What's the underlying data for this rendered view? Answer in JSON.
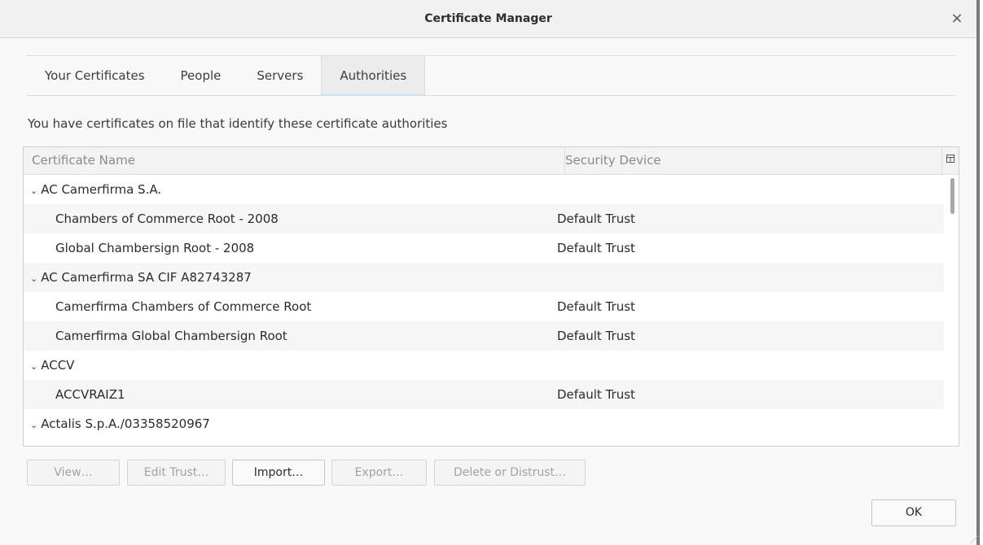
{
  "window": {
    "title": "Certificate Manager",
    "close_glyph": "×"
  },
  "tabs": [
    {
      "label": "Your Certificates",
      "active": false
    },
    {
      "label": "People",
      "active": false
    },
    {
      "label": "Servers",
      "active": false
    },
    {
      "label": "Authorities",
      "active": true
    }
  ],
  "description": "You have certificates on file that identify these certificate authorities",
  "table": {
    "columns": [
      "Certificate Name",
      "Security Device"
    ],
    "column_picker_icon": "column-picker-icon",
    "rows": [
      {
        "type": "parent",
        "name": "AC Camerfirma S.A.",
        "device": ""
      },
      {
        "type": "child",
        "name": "Chambers of Commerce Root - 2008",
        "device": "Default Trust"
      },
      {
        "type": "child",
        "name": "Global Chambersign Root - 2008",
        "device": "Default Trust"
      },
      {
        "type": "parent",
        "name": "AC Camerfirma SA CIF A82743287",
        "device": ""
      },
      {
        "type": "child",
        "name": "Camerfirma Chambers of Commerce Root",
        "device": "Default Trust"
      },
      {
        "type": "child",
        "name": "Camerfirma Global Chambersign Root",
        "device": "Default Trust"
      },
      {
        "type": "parent",
        "name": "ACCV",
        "device": ""
      },
      {
        "type": "child",
        "name": "ACCVRAIZ1",
        "device": "Default Trust"
      },
      {
        "type": "parent",
        "name": "Actalis S.p.A./03358520967",
        "device": ""
      }
    ]
  },
  "buttons": {
    "view": "View…",
    "edit_trust": "Edit Trust…",
    "import": "Import…",
    "export": "Export…",
    "delete_or_distrust": "Delete or Distrust…",
    "ok": "OK"
  },
  "colors": {
    "active_tab_underline": "#cfe8f7",
    "disabled_text": "#a3a3a3"
  }
}
